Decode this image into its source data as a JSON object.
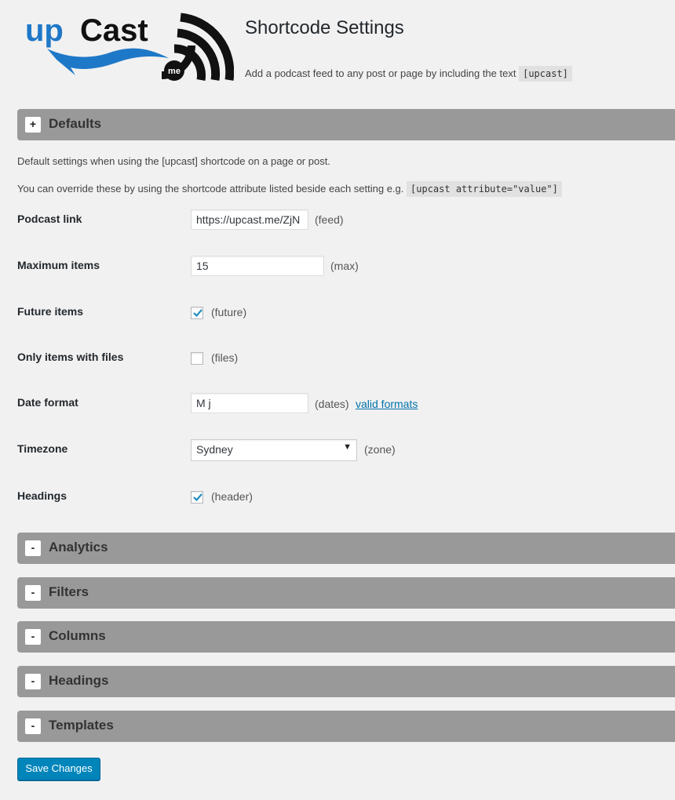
{
  "logo": {
    "text_up": "up",
    "text_cast": "Cast",
    "badge": "me"
  },
  "header": {
    "title": "Shortcode Settings",
    "intro_text": "Add a podcast feed to any post or page by including the text",
    "intro_code": "[upcast]"
  },
  "sections": {
    "defaults": {
      "toggle": "+",
      "title": "Defaults"
    },
    "analytics": {
      "toggle": "-",
      "title": "Analytics"
    },
    "filters": {
      "toggle": "-",
      "title": "Filters"
    },
    "columns": {
      "toggle": "-",
      "title": "Columns"
    },
    "headings": {
      "toggle": "-",
      "title": "Headings"
    },
    "templates": {
      "toggle": "-",
      "title": "Templates"
    }
  },
  "defaults": {
    "desc1": "Default settings when using the [upcast] shortcode on a page or post.",
    "desc2": "You can override these by using the shortcode attribute listed beside each setting e.g.",
    "desc2_code": "[upcast attribute=\"value\"]",
    "podcast_link": {
      "label": "Podcast link",
      "value": "https://upcast.me/ZjN",
      "attr": "(feed)"
    },
    "max_items": {
      "label": "Maximum items",
      "value": "15",
      "attr": "(max)"
    },
    "future_items": {
      "label": "Future items",
      "checked": true,
      "attr": "(future)"
    },
    "only_files": {
      "label": "Only items with files",
      "checked": false,
      "attr": "(files)"
    },
    "date_format": {
      "label": "Date format",
      "value": "M j",
      "attr": "(dates)",
      "link": "valid formats"
    },
    "timezone": {
      "label": "Timezone",
      "value": "Sydney",
      "attr": "(zone)"
    },
    "headings": {
      "label": "Headings",
      "checked": true,
      "attr": "(header)"
    }
  },
  "save_label": "Save Changes",
  "colors": {
    "section_bar": "#999999",
    "primary_button": "#0085ba",
    "link": "#0073aa",
    "logo_blue": "#1e78c8",
    "logo_dark": "#111111"
  }
}
